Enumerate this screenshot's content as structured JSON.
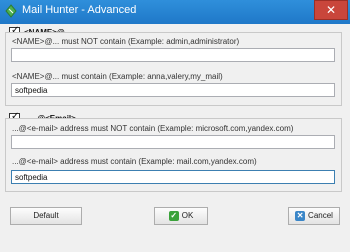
{
  "window": {
    "title": "Mail Hunter - Advanced",
    "close_glyph": "✕"
  },
  "name_group": {
    "checked": true,
    "header": "<NAME>@...",
    "not_contain_label": "<NAME>@... must NOT contain (Example: admin,administrator)",
    "not_contain_value": "",
    "contain_label": "<NAME>@... must contain (Example: anna,valery,my_mail)",
    "contain_value": "softpedia"
  },
  "email_group": {
    "checked": true,
    "header": "......@<Email>",
    "not_contain_label": "...@<e-mail> address must NOT contain (Example: microsoft.com,yandex.com)",
    "not_contain_value": "",
    "contain_label": "...@<e-mail> address must contain (Example: mail.com,yandex.com)",
    "contain_value": "softpedia"
  },
  "buttons": {
    "default_label": "Default",
    "ok_label": "OK",
    "cancel_label": "Cancel"
  },
  "icons": {
    "app": "mail-hunter-icon",
    "ok": "checkmark-icon",
    "cancel": "cross-icon"
  },
  "colors": {
    "titlebar": "#1f78c8",
    "close": "#c9463b",
    "ok_icon": "#3aa23a",
    "cancel_icon": "#3a86c8"
  }
}
